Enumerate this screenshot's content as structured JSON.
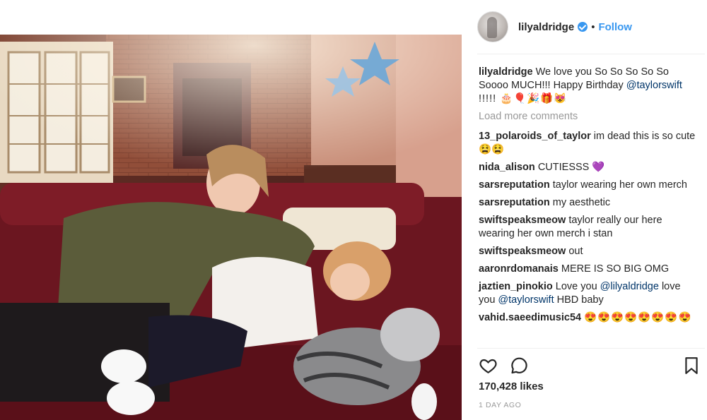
{
  "post": {
    "username": "lilyaldridge",
    "follow_label": "Follow",
    "separator": "•",
    "caption_user": "lilyaldridge",
    "caption_text": "We love you So So So So So Soooo MUCH!!! Happy Birthday",
    "caption_mention": "@taylorswift",
    "caption_tail": "!!!!! 🎂🎈🎉🎁😻",
    "load_more": "Load more comments",
    "likes": "170,428 likes",
    "timestamp": "1 DAY AGO"
  },
  "comments": [
    {
      "user": "13_polaroids_of_taylor",
      "text": "im dead this is so cute😫😫"
    },
    {
      "user": "nida_alison",
      "text": "CUTIESSS 💜"
    },
    {
      "user": "sarsreputation",
      "text": "taylor wearing her own merch"
    },
    {
      "user": "sarsreputation",
      "text": "my aesthetic"
    },
    {
      "user": "swiftspeaksmeow",
      "text": "taylor really our here wearing her own merch i stan"
    },
    {
      "user": "swiftspeaksmeow",
      "text": "out"
    },
    {
      "user": "aaronrdomanais",
      "text": "MERE IS SO BIG OMG"
    },
    {
      "user": "jaztien_pinokio",
      "text_before": "Love you",
      "mention1": "@lilyaldridge",
      "text_mid": "love you",
      "mention2": "@taylorswift",
      "text_after": "HBD baby"
    },
    {
      "user": "vahid.saeedimusic54",
      "text": "😍😍😍😍😍😍😍😍😍"
    }
  ],
  "icons": {
    "like": "heart-icon",
    "comment": "comment-icon",
    "save": "bookmark-icon",
    "verified": "verified-badge-icon"
  },
  "colors": {
    "link": "#3897f0",
    "mention": "#003569",
    "muted": "#999999",
    "text": "#262626"
  }
}
